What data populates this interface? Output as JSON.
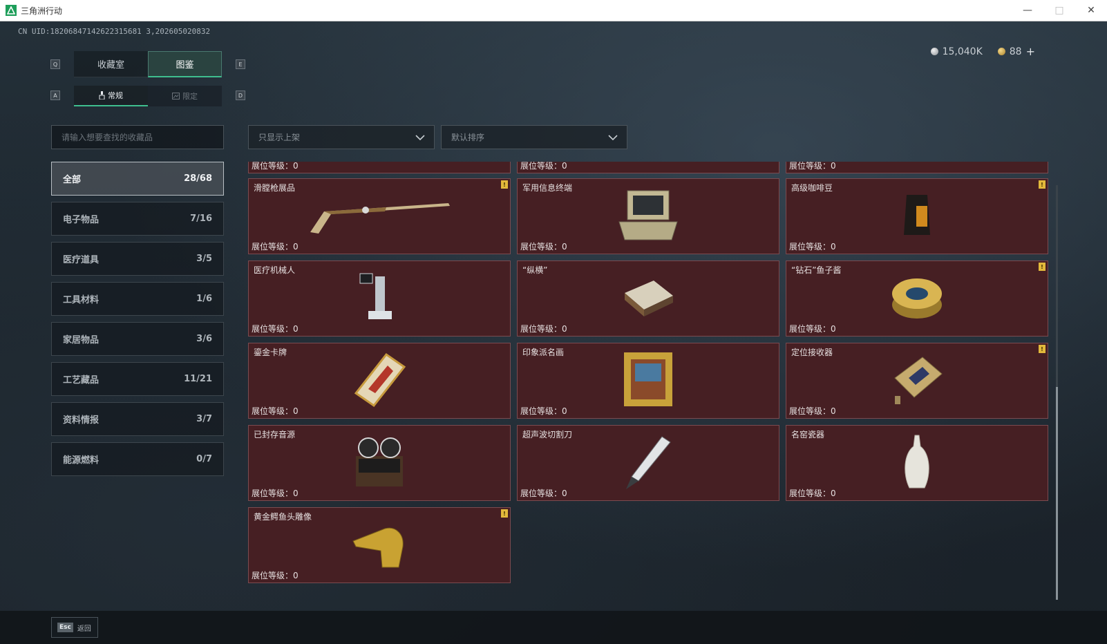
{
  "window": {
    "title": "三角洲行动"
  },
  "uid": "CN UID:18206847142622315681 3,202605020832",
  "currency": {
    "silver": "15,040K",
    "gold": "88",
    "plus": "+"
  },
  "hotkeys": {
    "tab_prev": "Q",
    "tab_next": "E",
    "sub_prev": "A",
    "sub_next": "D"
  },
  "tabs": [
    {
      "label": "收藏室"
    },
    {
      "label": "图鉴"
    }
  ],
  "subtabs": [
    {
      "label": "常规"
    },
    {
      "label": "限定"
    }
  ],
  "search": {
    "placeholder": "请输入想要查找的收藏品"
  },
  "filters": {
    "shelf": "只显示上架",
    "sort": "默认排序"
  },
  "categories": [
    {
      "label": "全部",
      "count": "28/68"
    },
    {
      "label": "电子物品",
      "count": "7/16"
    },
    {
      "label": "医疗道具",
      "count": "3/5"
    },
    {
      "label": "工具材料",
      "count": "1/6"
    },
    {
      "label": "家居物品",
      "count": "3/6"
    },
    {
      "label": "工艺藏品",
      "count": "11/21"
    },
    {
      "label": "资料情报",
      "count": "3/7"
    },
    {
      "label": "能源燃料",
      "count": "0/7"
    }
  ],
  "level_label": "展位等级：",
  "level_value": "0",
  "items": [
    {
      "name": "滑膛枪展品",
      "badge": "!"
    },
    {
      "name": "军用信息终端",
      "badge": ""
    },
    {
      "name": "高级咖啡豆",
      "badge": "!"
    },
    {
      "name": "医疗机械人",
      "badge": ""
    },
    {
      "name": "“纵横”",
      "badge": ""
    },
    {
      "name": "“钻石”鱼子酱",
      "badge": "!"
    },
    {
      "name": "鎏金卡牌",
      "badge": ""
    },
    {
      "name": "印象派名画",
      "badge": ""
    },
    {
      "name": "定位接收器",
      "badge": "!"
    },
    {
      "name": "已封存音源",
      "badge": ""
    },
    {
      "name": "超声波切割刀",
      "badge": ""
    },
    {
      "name": "名窑瓷器",
      "badge": ""
    },
    {
      "name": "黄金鳄鱼头雕像",
      "badge": "!"
    }
  ],
  "bottom": {
    "esc_key": "Esc",
    "back_label": "返回"
  },
  "colors": {
    "accent": "#3fbf8f",
    "card_bg": "#461f23",
    "badge": "#e2b93b"
  }
}
